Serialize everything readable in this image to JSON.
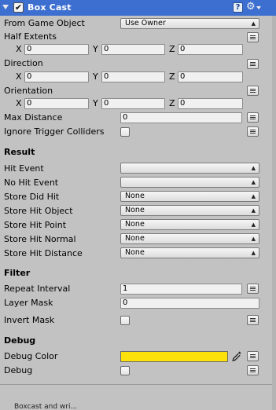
{
  "header": {
    "title": "Box Cast",
    "enabled_mark": "✔",
    "help_label": "?",
    "gear_glyph": "⚙",
    "accent_color": "#3d6fd1"
  },
  "fields": {
    "from_game_object": {
      "label": "From Game Object",
      "value": "Use Owner"
    },
    "half_extents": {
      "label": "Half Extents",
      "x_label": "X",
      "y_label": "Y",
      "z_label": "Z",
      "x": "0",
      "y": "0",
      "z": "0"
    },
    "direction": {
      "label": "Direction",
      "x_label": "X",
      "y_label": "Y",
      "z_label": "Z",
      "x": "0",
      "y": "0",
      "z": "0"
    },
    "orientation": {
      "label": "Orientation",
      "x_label": "X",
      "y_label": "Y",
      "z_label": "Z",
      "x": "0",
      "y": "0",
      "z": "0"
    },
    "max_distance": {
      "label": "Max Distance",
      "value": "0"
    },
    "ignore_trigger_colliders": {
      "label": "Ignore Trigger Colliders",
      "checked": false
    }
  },
  "result": {
    "title": "Result",
    "hit_event": {
      "label": "Hit Event",
      "value": ""
    },
    "no_hit_event": {
      "label": "No Hit Event",
      "value": ""
    },
    "store_did_hit": {
      "label": "Store Did Hit",
      "value": "None"
    },
    "store_hit_object": {
      "label": "Store Hit Object",
      "value": "None"
    },
    "store_hit_point": {
      "label": "Store Hit Point",
      "value": "None"
    },
    "store_hit_normal": {
      "label": "Store Hit Normal",
      "value": "None"
    },
    "store_hit_distance": {
      "label": "Store Hit Distance",
      "value": "None"
    }
  },
  "filter": {
    "title": "Filter",
    "repeat_interval": {
      "label": "Repeat Interval",
      "value": "1"
    },
    "layer_mask": {
      "label": "Layer Mask",
      "value": "0"
    },
    "invert_mask": {
      "label": "Invert Mask",
      "checked": false
    }
  },
  "debug": {
    "title": "Debug",
    "debug_color": {
      "label": "Debug Color",
      "color": "#fde10a"
    },
    "debug_toggle": {
      "label": "Debug",
      "checked": false
    }
  },
  "footer": {
    "partial_text": "Boxcast and wri..."
  }
}
